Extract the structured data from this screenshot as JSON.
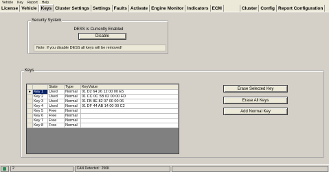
{
  "menubar": {
    "items": [
      "Vehicle",
      "Key",
      "Report",
      "Help"
    ]
  },
  "tabs": [
    "License",
    "Vehicle",
    "Keys",
    "Cluster Settings",
    "Settings",
    "Faults",
    "Activate",
    "Engine Monitor",
    "Indicators",
    "ECM",
    "",
    "Cluster",
    "Config",
    "Report Configuration"
  ],
  "active_tab": "Keys",
  "security": {
    "title": "Security System",
    "status": "DESS is Currently Enabled",
    "disable_label": "Disable",
    "note": "Note: If you disable DESS all keys will be removed!"
  },
  "keys": {
    "title": "Keys",
    "columns": [
      "State",
      "Type",
      "KeyValue"
    ],
    "rows": [
      {
        "pointer": "▸",
        "name": "Key 1",
        "state": "Used",
        "type": "Normal",
        "value": "01 D2 64 26 12 00 00 E5"
      },
      {
        "pointer": "",
        "name": "Key 2",
        "state": "Used",
        "type": "Normal",
        "value": "01 CC 0C 5B 02 00 00 FD"
      },
      {
        "pointer": "",
        "name": "Key 3",
        "state": "Used",
        "type": "Normal",
        "value": "01 FB 8E 82 07 00 00 06"
      },
      {
        "pointer": "",
        "name": "Key 4",
        "state": "Used",
        "type": "Normal",
        "value": "01 DF 44 AB 14 00 00 C2"
      },
      {
        "pointer": "",
        "name": "Key 5",
        "state": "Free",
        "type": "Normal",
        "value": ""
      },
      {
        "pointer": "",
        "name": "Key 6",
        "state": "Free",
        "type": "Normal",
        "value": ""
      },
      {
        "pointer": "",
        "name": "Key 7",
        "state": "Free",
        "type": "Normal",
        "value": ""
      },
      {
        "pointer": "",
        "name": "Key 8",
        "state": "Free",
        "type": "Normal",
        "value": ""
      }
    ],
    "erase_selected_label": "Erase Selected  Key",
    "erase_all_label": "Erase All Keys",
    "add_normal_label": "Add Normal Key"
  },
  "statusbar": {
    "left": "2",
    "center": "CAN Detected : 250K"
  }
}
